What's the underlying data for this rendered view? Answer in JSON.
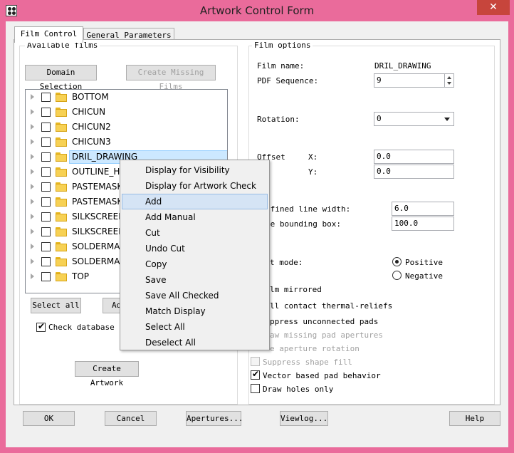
{
  "window": {
    "title": "Artwork Control Form",
    "close_glyph": "✕"
  },
  "tabs": [
    {
      "label": "Film Control",
      "active": true
    },
    {
      "label": "General Parameters",
      "active": false
    }
  ],
  "available_films": {
    "group_label": "Available films",
    "domain_selection": "Domain Selection",
    "create_missing": "Create Missing Films",
    "items": [
      {
        "label": "BOTTOM",
        "checked": false
      },
      {
        "label": "CHICUN",
        "checked": false
      },
      {
        "label": "CHICUN2",
        "checked": false
      },
      {
        "label": "CHICUN3",
        "checked": false
      },
      {
        "label": "DRIL_DRAWING",
        "checked": false,
        "selected": true
      },
      {
        "label": "OUTLINE_H",
        "checked": false
      },
      {
        "label": "PASTEMASK",
        "checked": false
      },
      {
        "label": "PASTEMASK",
        "checked": false
      },
      {
        "label": "SILKSCREEN",
        "checked": false
      },
      {
        "label": "SILKSCREEN",
        "checked": false
      },
      {
        "label": "SOLDERMAS",
        "checked": false
      },
      {
        "label": "SOLDERMAS",
        "checked": false
      },
      {
        "label": "TOP",
        "checked": false
      }
    ],
    "select_all": "Select all",
    "add_partial": "Ad",
    "check_db_label": "Check database be",
    "check_db_checked": true,
    "create_artwork": "Create Artwork"
  },
  "film_options": {
    "group_label": "Film options",
    "film_name_label": "Film name:",
    "film_name_value": "DRIL_DRAWING",
    "pdf_seq_label": "PDF Sequence:",
    "pdf_seq_value": "9",
    "rotation_label": "Rotation:",
    "rotation_value": "0",
    "offset_label": "Offset",
    "x_label": "X:",
    "x_value": "0.0",
    "y_label": "Y:",
    "y_value": "0.0",
    "undefined_lw_label": "efined line width:",
    "undefined_lw_value": "6.0",
    "shape_bb_label": "pe bounding box:",
    "shape_bb_value": "100.0",
    "plot_mode_label": "t mode:",
    "positive": "Positive",
    "negative": "Negative",
    "mode_selected": "Positive",
    "film_mirrored": "lm mirrored",
    "full_contact": "ll contact thermal-reliefs",
    "suppress_unconnected": "ppress unconnected pads",
    "draw_missing": "aw missing pad apertures",
    "use_aperture_rotation": "e aperture rotation",
    "suppress_shape_fill": "Suppress shape fill",
    "suppress_shape_fill_checked": false,
    "vector_based": "Vector based pad behavior",
    "vector_based_checked": true,
    "draw_holes": "Draw holes only",
    "draw_holes_checked": false
  },
  "context_menu": {
    "items": [
      "Display for Visibility",
      "Display for Artwork Check",
      "Add",
      "Add Manual",
      "Cut",
      "Undo Cut",
      "Copy",
      "Save",
      "Save All Checked",
      "Match Display",
      "Select All",
      "Deselect All"
    ],
    "highlighted": "Add"
  },
  "footer": {
    "ok": "OK",
    "cancel": "Cancel",
    "apertures": "Apertures...",
    "viewlog": "Viewlog...",
    "help": "Help"
  }
}
